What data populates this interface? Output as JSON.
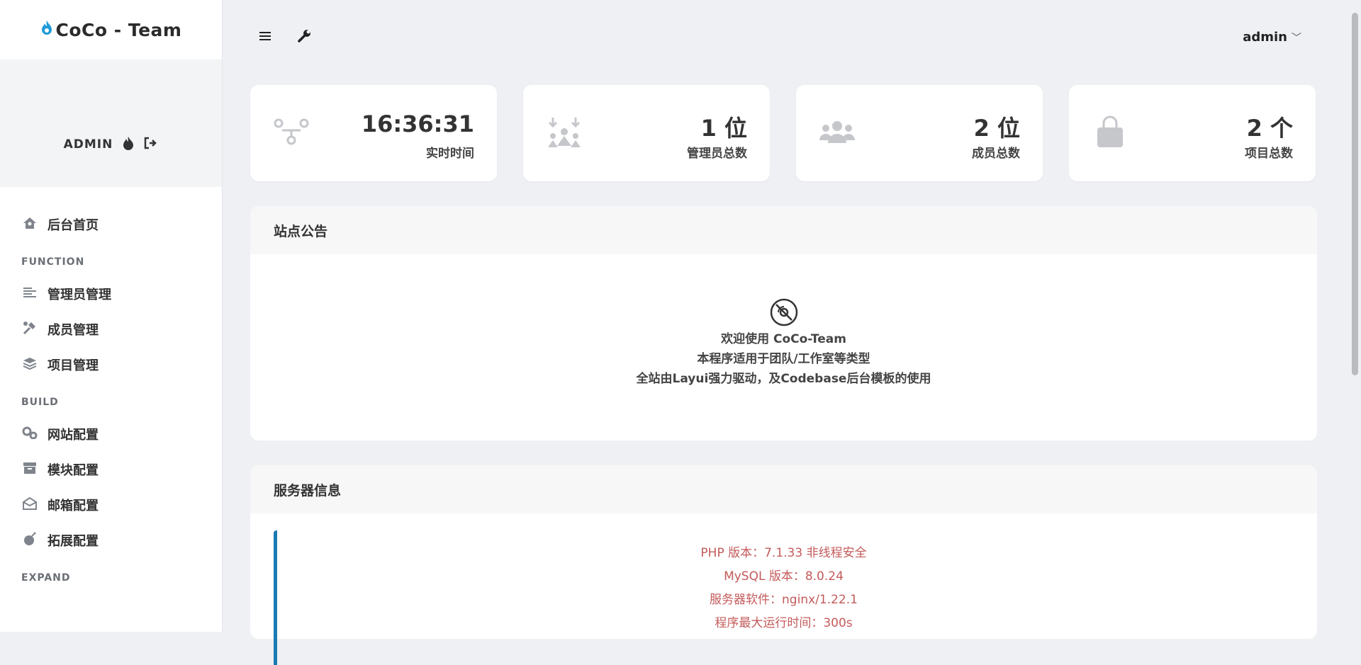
{
  "brand": {
    "icon": "flame-icon",
    "title": "CoCo - Team"
  },
  "user": {
    "name": "ADMIN"
  },
  "sidebar": {
    "home": {
      "label": "后台首页",
      "icon": "home-icon"
    },
    "sections": [
      {
        "title": "FUNCTION"
      },
      {
        "title": "BUILD"
      },
      {
        "title": "EXPAND"
      }
    ],
    "function_items": [
      {
        "label": "管理员管理",
        "icon": "list-icon"
      },
      {
        "label": "成员管理",
        "icon": "tools-icon"
      },
      {
        "label": "项目管理",
        "icon": "layers-icon"
      }
    ],
    "build_items": [
      {
        "label": "网站配置",
        "icon": "gears-icon"
      },
      {
        "label": "模块配置",
        "icon": "box-icon"
      },
      {
        "label": "邮箱配置",
        "icon": "envelope-open-icon"
      },
      {
        "label": "拓展配置",
        "icon": "bomb-icon"
      }
    ]
  },
  "topbar": {
    "user_label": "admin"
  },
  "stats": [
    {
      "value": "16:36:31",
      "label": "实时时间",
      "icon": "network-icon"
    },
    {
      "value": "1 位",
      "label": "管理员总数",
      "icon": "people-arrows-icon"
    },
    {
      "value": "2 位",
      "label": "成员总数",
      "icon": "users-icon"
    },
    {
      "value": "2 个",
      "label": "项目总数",
      "icon": "shopping-bag-icon"
    }
  ],
  "notice": {
    "title": "站点公告",
    "icon": "disc-icon",
    "lines": [
      "欢迎使用 CoCo-Team",
      "本程序适用于团队/工作室等类型",
      "全站由Layui强力驱动，及Codebase后台模板的使用"
    ]
  },
  "server": {
    "title": "服务器信息",
    "lines": [
      "PHP 版本：7.1.33 非线程安全",
      "MySQL 版本：8.0.24",
      "服务器软件：nginx/1.22.1",
      "程序最大运行时间：300s"
    ]
  },
  "colors": {
    "accent": "#1a7ab3",
    "brand_flame": "#1e9bd7",
    "server_text": "#c45a5a"
  }
}
